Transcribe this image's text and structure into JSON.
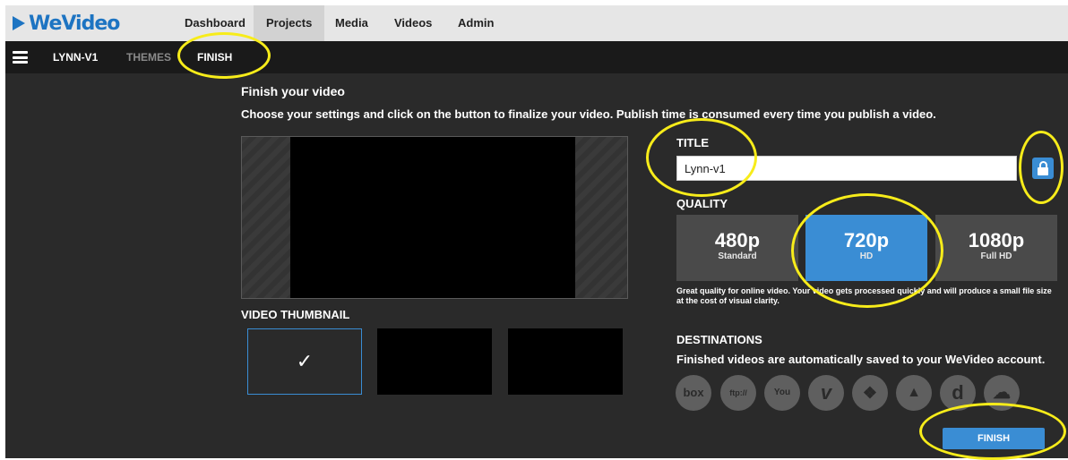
{
  "brand": {
    "logo_text": "WeVideo"
  },
  "top_nav": {
    "items": [
      {
        "label": "Dashboard",
        "active": false
      },
      {
        "label": "Projects",
        "active": true
      },
      {
        "label": "Media",
        "active": false
      },
      {
        "label": "Videos",
        "active": false
      },
      {
        "label": "Admin",
        "active": false
      }
    ]
  },
  "sub_nav": {
    "project_name": "LYNN-V1",
    "themes_label": "THEMES",
    "finish_label": "FINISH"
  },
  "main": {
    "heading": "Finish your video",
    "description": "Choose your settings and click on the button to finalize your video. Publish time is consumed every time you publish a video.",
    "thumbnail_label": "VIDEO THUMBNAIL",
    "title_label": "TITLE",
    "title_value": "Lynn-v1",
    "quality_label": "QUALITY",
    "quality_options": [
      {
        "label": "480p",
        "sub": "Standard",
        "selected": false
      },
      {
        "label": "720p",
        "sub": "HD",
        "selected": true
      },
      {
        "label": "1080p",
        "sub": "Full HD",
        "selected": false
      }
    ],
    "quality_description": "Great quality for online video. Your video gets processed quickly and will produce a small file size at the cost of visual clarity.",
    "destinations_label": "DESTINATIONS",
    "destinations_desc": "Finished videos are automatically saved to your WeVideo account.",
    "destinations": [
      {
        "icon": "box-icon",
        "text": "box"
      },
      {
        "icon": "ftp-icon",
        "text": "ftp://"
      },
      {
        "icon": "youtube-icon",
        "text": "You"
      },
      {
        "icon": "vimeo-icon",
        "text": "v"
      },
      {
        "icon": "dropbox-icon",
        "text": "❖"
      },
      {
        "icon": "google-drive-icon",
        "text": "▲"
      },
      {
        "icon": "dailymotion-icon",
        "text": "d"
      },
      {
        "icon": "cloud-icon",
        "text": "☁"
      }
    ],
    "finish_button": "FINISH"
  },
  "colors": {
    "accent": "#3a8dd4",
    "highlight": "#f7ec1a",
    "background": "#2a2a2a"
  }
}
